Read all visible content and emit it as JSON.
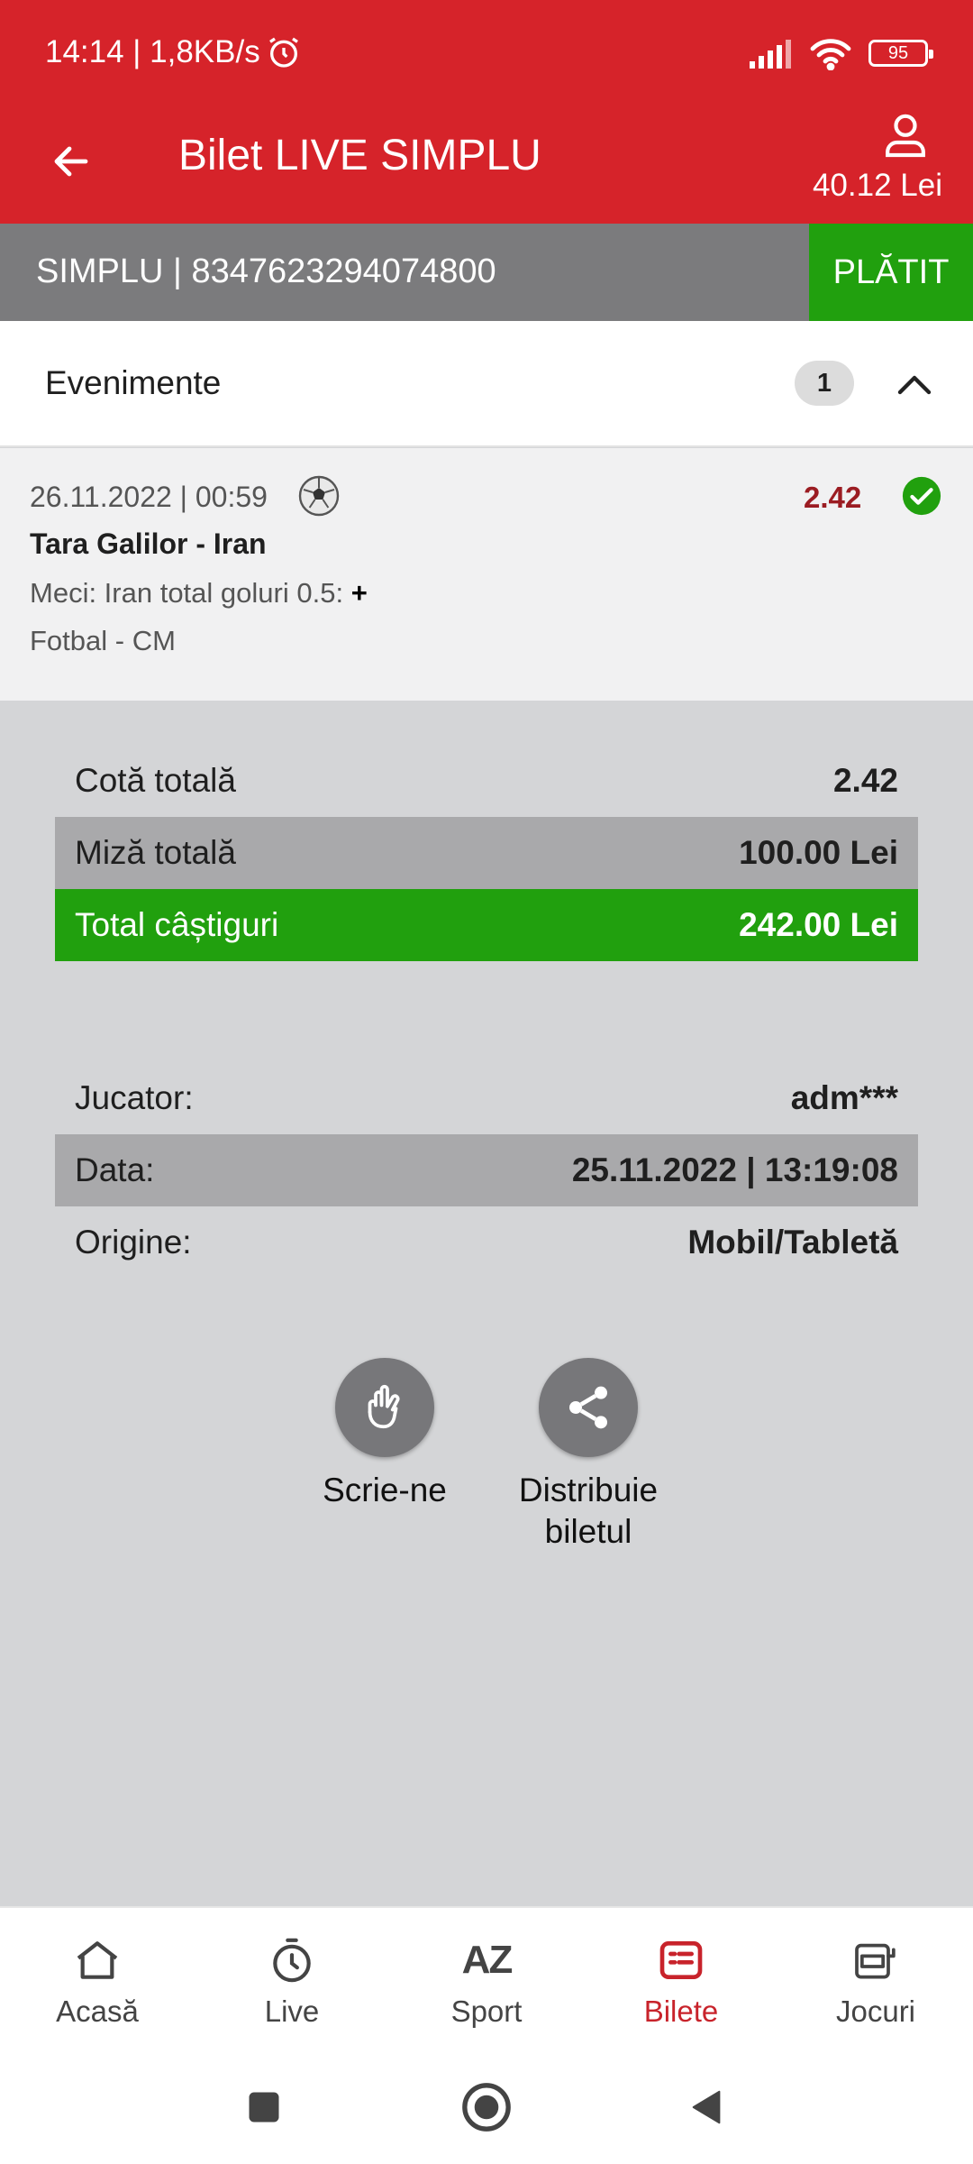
{
  "status_bar": {
    "time_speed": "14:14 | 1,8KB/s",
    "battery": "95"
  },
  "app_bar": {
    "title": "Bilet LIVE SIMPLU",
    "balance": "40.12 Lei"
  },
  "ticket": {
    "id_line": "SIMPLU | 8347623294074800",
    "status": "PLĂTIT"
  },
  "events": {
    "title": "Evenimente",
    "count": "1",
    "items": [
      {
        "datetime": "26.11.2022 | 00:59",
        "odds": "2.42",
        "match": "Tara Galilor - Iran",
        "market": "Meci: Iran total goluri 0.5:",
        "selection": "+",
        "league": "Fotbal - CM"
      }
    ]
  },
  "summary": {
    "total_odds_label": "Cotă totală",
    "total_odds_value": "2.42",
    "stake_label": "Miză totală",
    "stake_value": "100.00 Lei",
    "winnings_label": "Total câștiguri",
    "winnings_value": "242.00 Lei"
  },
  "details": {
    "player_label": "Jucator:",
    "player_value": "adm***",
    "date_label": "Data:",
    "date_value": "25.11.2022 | 13:19:08",
    "origin_label": "Origine:",
    "origin_value": "Mobil/Tabletă"
  },
  "actions": {
    "contact_label": "Scrie-ne",
    "share_label_1": "Distribuie",
    "share_label_2": "biletul"
  },
  "bottom_nav": {
    "items": [
      {
        "label": "Acasă",
        "icon": "home-icon"
      },
      {
        "label": "Live",
        "icon": "stopwatch-icon"
      },
      {
        "label": "Sport",
        "icon": "az-icon"
      },
      {
        "label": "Bilete",
        "icon": "ticket-list-icon"
      },
      {
        "label": "Jocuri",
        "icon": "slot-machine-icon"
      }
    ],
    "active": "Bilete",
    "active_color": "#c8232b"
  },
  "colors": {
    "brand_red": "#d6232a",
    "paid_green": "#21a00e",
    "odds_red": "#9b1c22"
  }
}
